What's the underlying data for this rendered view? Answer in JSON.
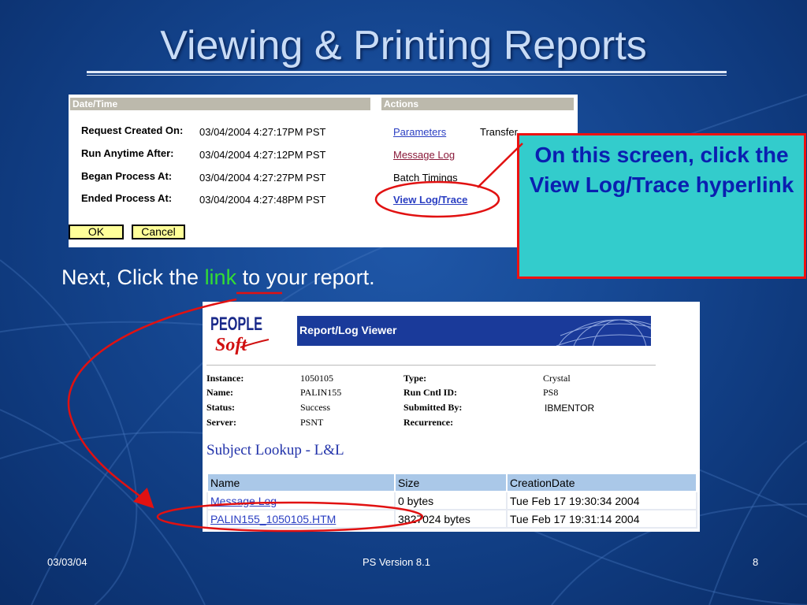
{
  "slide": {
    "title": "Viewing & Printing Reports",
    "callout": "On this screen, click the View Log/Trace hyperlink",
    "next_prefix": "Next, Click the ",
    "next_link": "link",
    "next_suffix": " to your report."
  },
  "process_detail": {
    "header_left": "Date/Time",
    "header_right": "Actions",
    "rows": [
      {
        "label": "Request Created On:",
        "value": "03/04/2004  4:27:17PM PST"
      },
      {
        "label": "Run Anytime After:",
        "value": "03/04/2004  4:27:12PM PST"
      },
      {
        "label": "Began Process At:",
        "value": "03/04/2004  4:27:27PM PST"
      },
      {
        "label": "Ended Process At:",
        "value": "03/04/2004  4:27:48PM PST"
      }
    ],
    "actions": {
      "parameters": "Parameters",
      "transfer": "Transfer",
      "message_log": "Message Log",
      "batch_timings": "Batch Timings",
      "view_log_trace": "View Log/Trace"
    },
    "ok_label": "OK",
    "cancel_label": "Cancel"
  },
  "viewer": {
    "logo_top": "PEOPLE",
    "logo_bottom": "Soft",
    "bar_title": "Report/Log Viewer",
    "fields": {
      "instance_label": "Instance:",
      "instance_value": "1050105",
      "name_label": "Name:",
      "name_value": "PALIN155",
      "status_label": "Status:",
      "status_value": "Success",
      "server_label": "Server:",
      "server_value": "PSNT",
      "type_label": "Type:",
      "type_value": "Crystal",
      "runcntl_label": "Run Cntl ID:",
      "runcntl_value": "PS8",
      "submitted_label": "Submitted By:",
      "submitted_value": "IBMENTOR",
      "recurrence_label": "Recurrence:"
    },
    "subject": "Subject Lookup - L&L",
    "columns": [
      "Name",
      "Size",
      "CreationDate"
    ],
    "files": [
      {
        "name": "Message Log",
        "size": "0 bytes",
        "date": "Tue Feb 17 19:30:34 2004"
      },
      {
        "name": "PALIN155_1050105.HTM",
        "size": "3827024 bytes",
        "date": "Tue Feb 17 19:31:14 2004"
      }
    ]
  },
  "footer": {
    "date": "03/03/04",
    "version": "PS Version 8.1",
    "page": "8"
  },
  "colors": {
    "accent_red": "#e11111",
    "callout_bg": "#33cccc",
    "callout_text": "#0a1fb0",
    "link_green": "#33dd33"
  }
}
